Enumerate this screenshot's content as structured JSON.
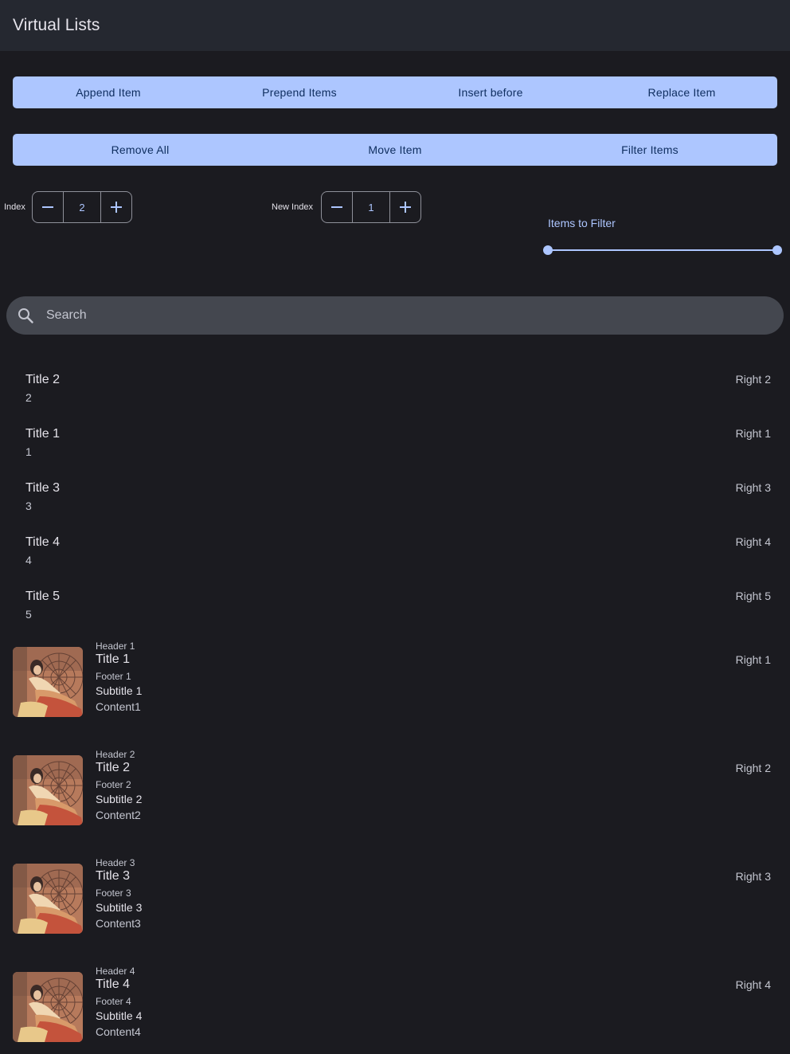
{
  "app": {
    "title": "Virtual Lists"
  },
  "actions_row1": [
    "Append Item",
    "Prepend Items",
    "Insert before",
    "Replace Item"
  ],
  "actions_row2": [
    "Remove All",
    "Move Item",
    "Filter Items"
  ],
  "index_stepper": {
    "label": "Index",
    "value": "2"
  },
  "new_index_stepper": {
    "label": "New Index",
    "value": "1"
  },
  "filter": {
    "label": "Items to Filter",
    "range_start": 0.0,
    "range_end": 1.0
  },
  "search": {
    "placeholder": "Search",
    "icon": "search-icon"
  },
  "simple_items": [
    {
      "title": "Title 2",
      "subtitle": "2",
      "right": "Right 2"
    },
    {
      "title": "Title 1",
      "subtitle": "1",
      "right": "Right 1"
    },
    {
      "title": "Title 3",
      "subtitle": "3",
      "right": "Right 3"
    },
    {
      "title": "Title 4",
      "subtitle": "4",
      "right": "Right 4"
    },
    {
      "title": "Title 5",
      "subtitle": "5",
      "right": "Right 5"
    }
  ],
  "rich_items": [
    {
      "header": "Header 1",
      "title": "Title 1",
      "footer": "Footer 1",
      "subtitle": "Subtitle 1",
      "content": "Content1",
      "right": "Right 1",
      "image": "painting-thumbnail"
    },
    {
      "header": "Header 2",
      "title": "Title 2",
      "footer": "Footer 2",
      "subtitle": "Subtitle 2",
      "content": "Content2",
      "right": "Right 2",
      "image": "painting-thumbnail"
    },
    {
      "header": "Header 3",
      "title": "Title 3",
      "footer": "Footer 3",
      "subtitle": "Subtitle 3",
      "content": "Content3",
      "right": "Right 3",
      "image": "painting-thumbnail"
    },
    {
      "header": "Header 4",
      "title": "Title 4",
      "footer": "Footer 4",
      "subtitle": "Subtitle 4",
      "content": "Content4",
      "right": "Right 4",
      "image": "painting-thumbnail"
    }
  ],
  "colors": {
    "background": "#1b1b20",
    "appbar": "#252830",
    "primary": "#adc6ff",
    "on_primary": "#102f60",
    "search_bg": "#44474f",
    "thumbnail": "#b77a5c"
  }
}
